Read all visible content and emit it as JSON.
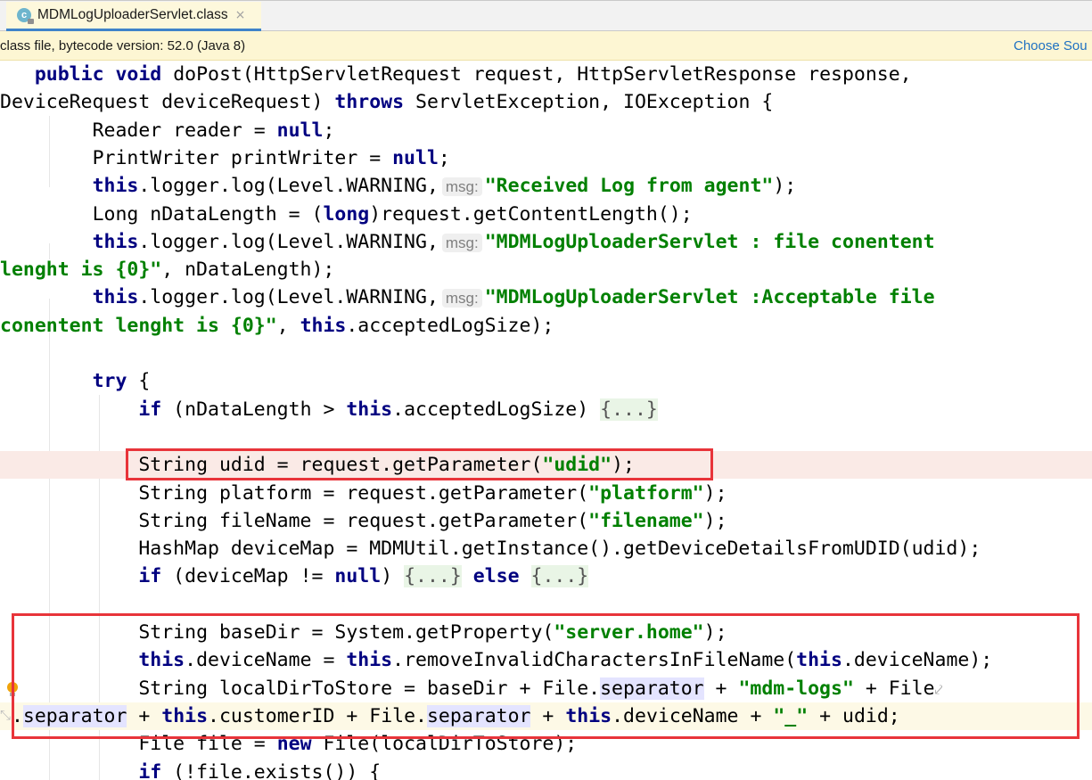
{
  "tab": {
    "icon": "class-file-icon",
    "icon_letter": "c",
    "title": "MDMLogUploaderServlet.class",
    "close": "×"
  },
  "infobar": {
    "message": "class file, bytecode version: 52.0 (Java 8)",
    "action": "Choose Sou"
  },
  "hint_label": "msg:",
  "code": {
    "l1": [
      "public",
      "void",
      " doPost(HttpServletRequest request, HttpServletResponse response,"
    ],
    "l2": [
      "DeviceRequest deviceRequest) ",
      "throws",
      " ServletException, IOException {"
    ],
    "l3": [
      "Reader reader = ",
      "null",
      ";"
    ],
    "l4": [
      "PrintWriter printWriter = ",
      "null",
      ";"
    ],
    "l5": [
      "this",
      ".logger.log(Level.WARNING,",
      "\"Received Log from agent\"",
      ");"
    ],
    "l6": [
      "Long nDataLength = (",
      "long",
      ")request.getContentLength();"
    ],
    "l7": [
      "this",
      ".logger.log(Level.WARNING,",
      "\"MDMLogUploaderServlet : file conentent"
    ],
    "l8": [
      "lenght is {0}\"",
      ", nDataLength);"
    ],
    "l9": [
      "this",
      ".logger.log(Level.WARNING,",
      "\"MDMLogUploaderServlet :Acceptable file"
    ],
    "l10": [
      "conentent lenght is {0}\"",
      ", ",
      "this",
      ".acceptedLogSize);"
    ],
    "l11": [
      "try",
      " {"
    ],
    "l12": [
      "if",
      " (nDataLength > ",
      "this",
      ".acceptedLogSize) ",
      "{...}"
    ],
    "l13": [
      "String udid = request.getParameter(",
      "\"udid\"",
      ");"
    ],
    "l14": [
      "String platform = request.getParameter(",
      "\"platform\"",
      ");"
    ],
    "l15": [
      "String fileName = request.getParameter(",
      "\"filename\"",
      ");"
    ],
    "l16": [
      "HashMap deviceMap = MDMUtil.getInstance().getDeviceDetailsFromUDID(udid);"
    ],
    "l17": [
      "if",
      " (deviceMap != ",
      "null",
      ") ",
      "{...}",
      " ",
      "else",
      " ",
      "{...}"
    ],
    "l18": [
      "String baseDir = System.getProperty(",
      "\"server.home\"",
      ");"
    ],
    "l19": [
      "this",
      ".deviceName = ",
      "this",
      ".removeInvalidCharactersInFileName(",
      "this",
      ".deviceName);"
    ],
    "l20": [
      "String localDirToStore = baseDir + File.",
      "separator",
      " + ",
      "\"mdm-logs\"",
      " + File"
    ],
    "l21": [
      ".",
      "separator",
      " + ",
      "this",
      ".customerID + File.",
      "separator",
      " + ",
      "this",
      ".deviceName + ",
      "\"_\"",
      " + udid;"
    ],
    "l22": [
      "File file = ",
      "new",
      " File(localDirToStore);"
    ],
    "l23": [
      "if",
      " (!file.exists()) {"
    ]
  }
}
